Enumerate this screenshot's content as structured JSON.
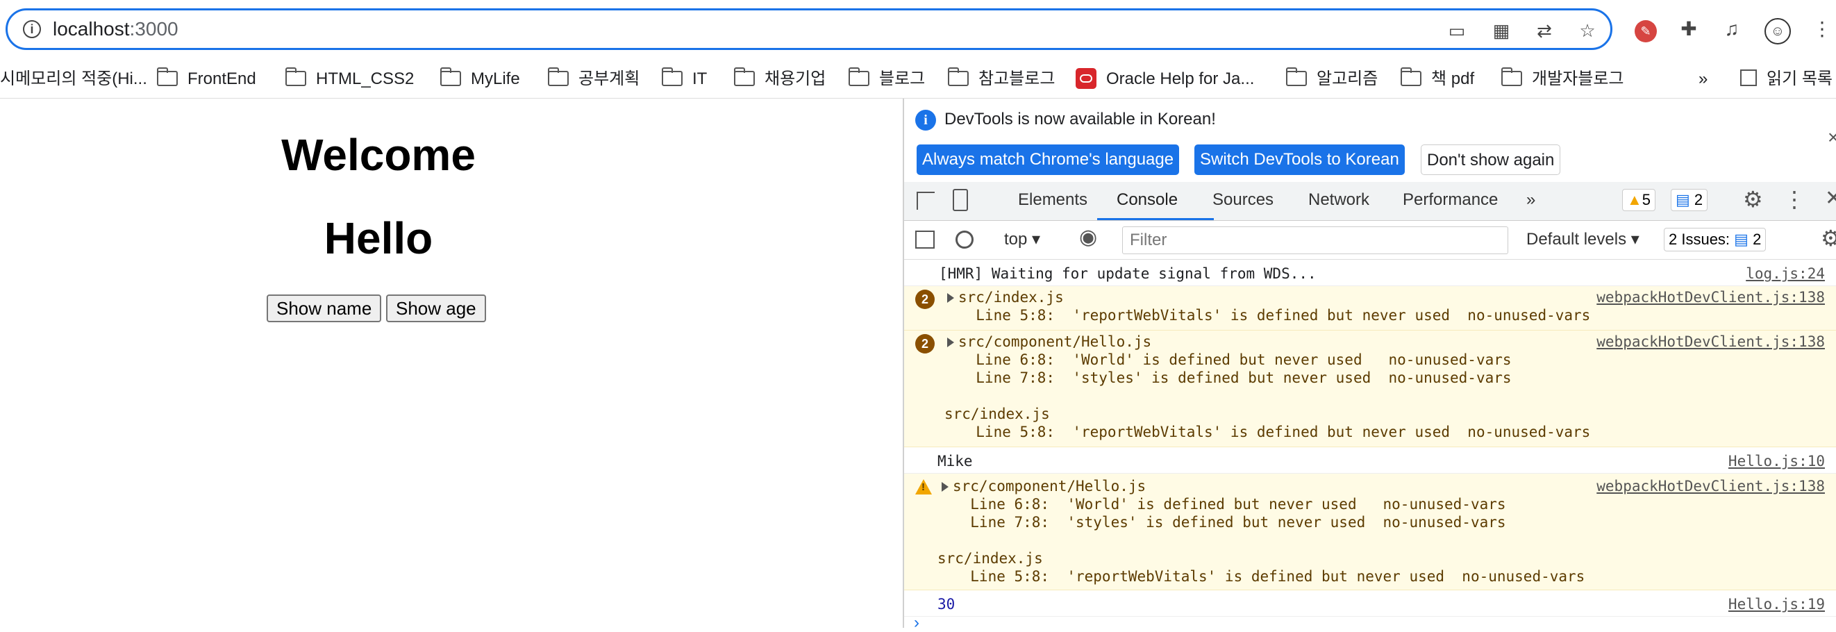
{
  "browser": {
    "url_host": "localhost",
    "url_port": ":3000",
    "extension_icons": [
      "cast-icon",
      "qr-code-icon",
      "translate-icon",
      "star-icon",
      "pencil-extension-icon",
      "puzzle-icon",
      "media-control-icon",
      "profile-avatar-icon",
      "kebab-menu-icon"
    ]
  },
  "bookmarks": {
    "items": [
      {
        "label": "시메모리의 적중(Hi..."
      },
      {
        "label": "FrontEnd"
      },
      {
        "label": "HTML_CSS2"
      },
      {
        "label": "MyLife"
      },
      {
        "label": "공부계획"
      },
      {
        "label": "IT"
      },
      {
        "label": "채용기업"
      },
      {
        "label": "블로그"
      },
      {
        "label": "참고블로그"
      },
      {
        "label": "Oracle Help for Ja..."
      },
      {
        "label": "알고리즘"
      },
      {
        "label": "책 pdf"
      },
      {
        "label": "개발자블로그"
      }
    ],
    "overflow": "»",
    "reading_list": "읽기 목록"
  },
  "page": {
    "heading1": "Welcome",
    "heading2": "Hello",
    "show_name_button": "Show name",
    "show_age_button": "Show age"
  },
  "devtools": {
    "info_message": "DevTools is now available in Korean!",
    "match_language_button": "Always match Chrome's language",
    "switch_korean_button": "Switch DevTools to Korean",
    "dont_show_button": "Don't show again",
    "close": "×",
    "tabs": [
      "Elements",
      "Console",
      "Sources",
      "Network",
      "Performance"
    ],
    "more_tabs": "»",
    "warning_count": "5",
    "message_count": "2",
    "context": "top",
    "filter_placeholder": "Filter",
    "levels": "Default levels",
    "issues_label": "2 Issues:",
    "issues_count": "2"
  },
  "console": {
    "entries": [
      {
        "text": "[HMR] Waiting for update signal from WDS...",
        "source": "log.js:24"
      },
      {
        "count": "2",
        "title": "src/index.js",
        "source": "webpackHotDevClient.js:138",
        "lines": [
          "  Line 5:8:  'reportWebVitals' is defined but never used  no-unused-vars"
        ]
      },
      {
        "count": "2",
        "title": "src/component/Hello.js",
        "source": "webpackHotDevClient.js:138",
        "lines": [
          "  Line 6:8:  'World' is defined but never used   no-unused-vars",
          "  Line 7:8:  'styles' is defined but never used  no-unused-vars",
          "",
          "src/index.js",
          "  Line 5:8:  'reportWebVitals' is defined but never used  no-unused-vars"
        ]
      },
      {
        "text": "Mike",
        "source": "Hello.js:10"
      },
      {
        "title": "src/component/Hello.js",
        "source": "webpackHotDevClient.js:138",
        "lines": [
          "  Line 6:8:  'World' is defined but never used   no-unused-vars",
          "  Line 7:8:  'styles' is defined but never used  no-unused-vars",
          "",
          "src/index.js",
          "  Line 5:8:  'reportWebVitals' is defined but never used  no-unused-vars"
        ]
      },
      {
        "text": "30",
        "source": "Hello.js:19"
      }
    ],
    "prompt": "›"
  },
  "colors": {
    "accent": "#1a73e8",
    "warning_bg": "#fffbe5",
    "number_blue": "#1a1aa6"
  }
}
